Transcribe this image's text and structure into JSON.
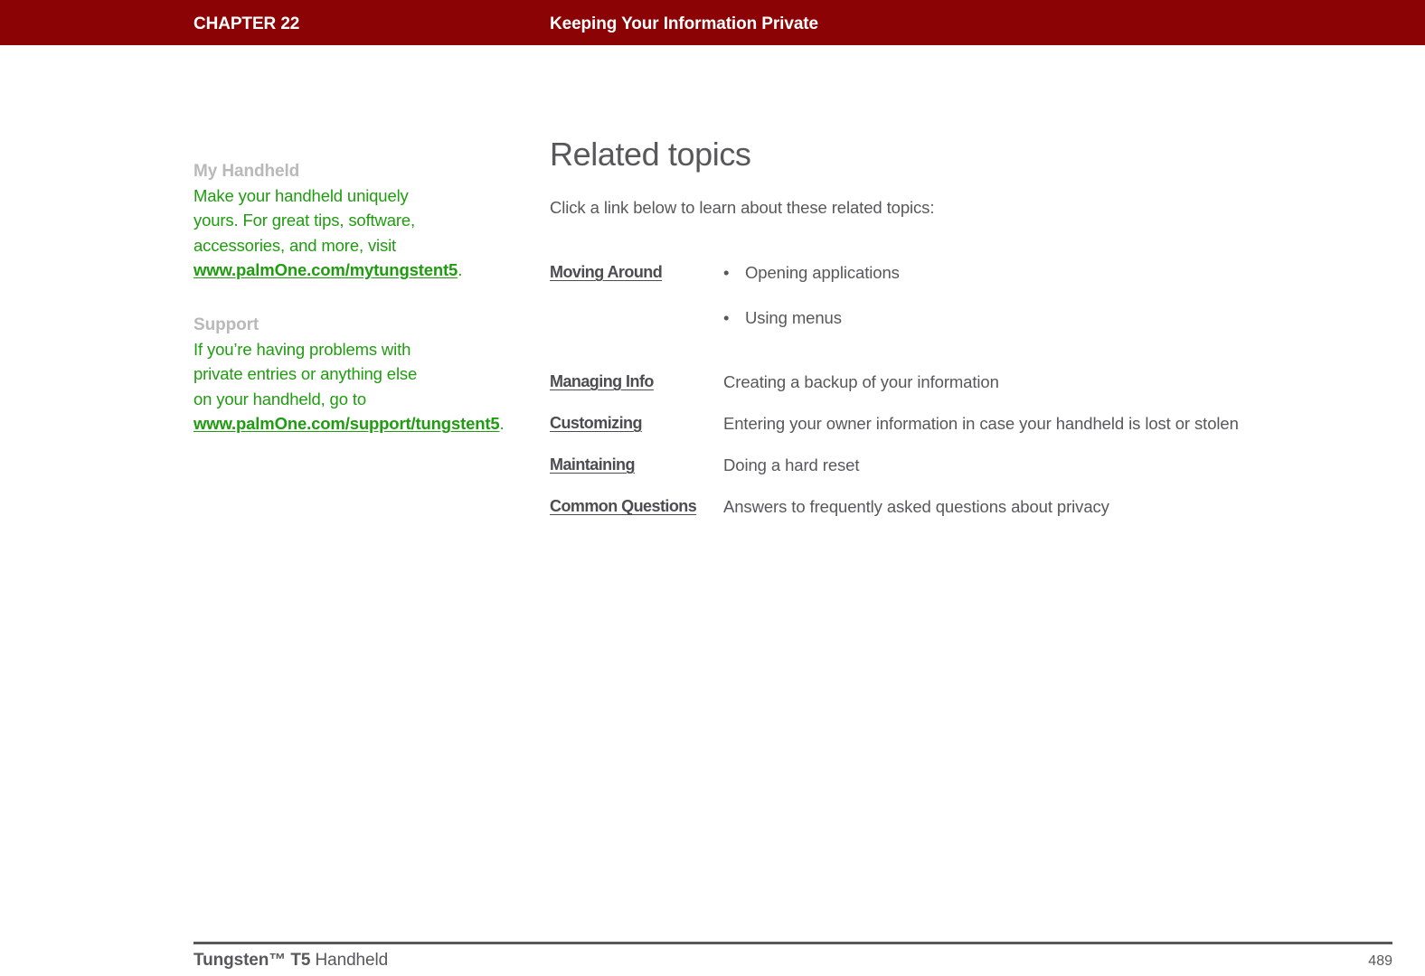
{
  "header": {
    "chapter": "CHAPTER 22",
    "title": "Keeping Your Information Private",
    "bar_color": "#8b0304"
  },
  "sidebar": {
    "blocks": [
      {
        "heading": "My Handheld",
        "body_before": "Make your handheld uniquely yours. For great tips, software, accessories, and more, visit ",
        "link": "www.palmOne.com/mytungstent5",
        "body_after": "."
      },
      {
        "heading": "Support",
        "body_before": "If you’re having problems with private entries or anything else on your handheld, go to ",
        "link": "www.palmOne.com/support/tungstent5",
        "body_after": "."
      }
    ],
    "heading_color": "#b9b9b9",
    "text_color": "#1f9c0f"
  },
  "main": {
    "title": "Related topics",
    "intro": "Click a link below to learn about these related topics:",
    "topics": [
      {
        "link": "Moving Around",
        "bullets": [
          "Opening applications",
          "Using menus"
        ],
        "description": ""
      },
      {
        "link": "Managing Info",
        "bullets": [],
        "description": "Creating a backup of your information"
      },
      {
        "link": "Customizing",
        "bullets": [],
        "description": "Entering your owner information in case your handheld is lost or stolen"
      },
      {
        "link": "Maintaining",
        "bullets": [],
        "description": "Doing a hard reset"
      },
      {
        "link": "Common Questions",
        "bullets": [],
        "description": "Answers to frequently asked questions about privacy"
      }
    ]
  },
  "footer": {
    "product_bold": "Tungsten™ T5",
    "product_rest": " Handheld",
    "page_number": "489"
  }
}
